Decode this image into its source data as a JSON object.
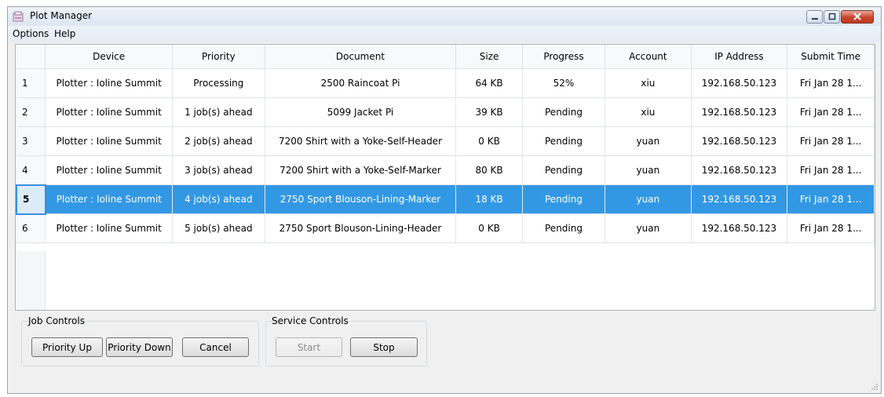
{
  "window": {
    "title": "Plot Manager"
  },
  "menu": {
    "items": [
      "Options",
      "Help"
    ]
  },
  "table": {
    "columns": [
      "Device",
      "Priority",
      "Document",
      "Size",
      "Progress",
      "Account",
      "IP Address",
      "Submit Time"
    ],
    "rows": [
      {
        "num": "1",
        "cells": [
          "Plotter : Ioline Summit",
          "Processing",
          "2500 Raincoat Pi",
          "64 KB",
          "52%",
          "xiu",
          "192.168.50.123",
          "Fri Jan 28 1..."
        ]
      },
      {
        "num": "2",
        "cells": [
          "Plotter : Ioline Summit",
          "1 job(s) ahead",
          "5099 Jacket Pi",
          "39 KB",
          "Pending",
          "xiu",
          "192.168.50.123",
          "Fri Jan 28 1..."
        ]
      },
      {
        "num": "3",
        "cells": [
          "Plotter : Ioline Summit",
          "2 job(s) ahead",
          "7200 Shirt with a Yoke-Self-Header",
          "0 KB",
          "Pending",
          "yuan",
          "192.168.50.123",
          "Fri Jan 28 1..."
        ]
      },
      {
        "num": "4",
        "cells": [
          "Plotter : Ioline Summit",
          "3 job(s) ahead",
          "7200 Shirt with a Yoke-Self-Marker",
          "80 KB",
          "Pending",
          "yuan",
          "192.168.50.123",
          "Fri Jan 28 1..."
        ]
      },
      {
        "num": "5",
        "cells": [
          "Plotter : Ioline Summit",
          "4 job(s) ahead",
          "2750 Sport Blouson-Lining-Marker",
          "18 KB",
          "Pending",
          "yuan",
          "192.168.50.123",
          "Fri Jan 28 1..."
        ],
        "selected": true
      },
      {
        "num": "6",
        "cells": [
          "Plotter : Ioline Summit",
          "5 job(s) ahead",
          "2750 Sport Blouson-Lining-Header",
          "0 KB",
          "Pending",
          "yuan",
          "192.168.50.123",
          "Fri Jan 28 1..."
        ]
      }
    ]
  },
  "job_controls": {
    "title": "Job Controls",
    "priority_up": "Priority Up",
    "priority_down": "Priority Down",
    "cancel": "Cancel"
  },
  "service_controls": {
    "title": "Service Controls",
    "start": "Start",
    "stop": "Stop"
  },
  "colors": {
    "selection": "#3398e4",
    "close_button": "#c8442b"
  }
}
